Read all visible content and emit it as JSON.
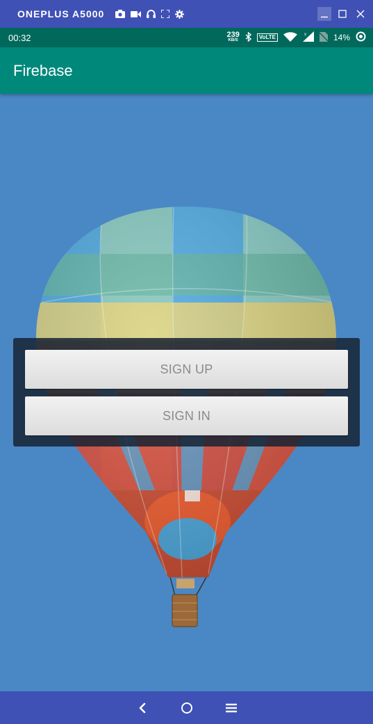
{
  "window": {
    "device_name": "ONEPLUS A5000",
    "toolbar_icons": [
      "camera-icon",
      "video-icon",
      "headphones-icon",
      "fullscreen-icon",
      "settings-icon"
    ],
    "controls": [
      "minimize-icon",
      "maximize-icon",
      "close-icon"
    ]
  },
  "status_bar": {
    "time": "00:32",
    "net_speed": "239",
    "net_unit": "KB/S",
    "volte": "VoLTE",
    "battery": "14%",
    "icons": [
      "bluetooth-icon",
      "wifi-icon",
      "signal-icon",
      "no-sim-icon",
      "battery-saver-icon"
    ]
  },
  "app_bar": {
    "title": "Firebase"
  },
  "main": {
    "sign_up_label": "SIGN UP",
    "sign_in_label": "SIGN IN"
  },
  "nav_bar": {
    "buttons": [
      "back-icon",
      "home-icon",
      "menu-icon"
    ]
  },
  "colors": {
    "window_bar": "#3f51b5",
    "status_bar": "#00695c",
    "app_bar": "#00897b",
    "sky": "#4a87c5",
    "button_text": "#8a8a8a"
  }
}
